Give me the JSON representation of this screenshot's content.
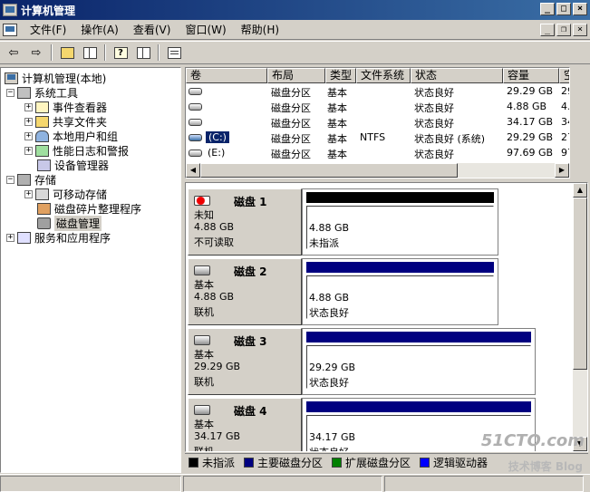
{
  "window": {
    "title": "计算机管理"
  },
  "menu": {
    "items": [
      "文件(F)",
      "操作(A)",
      "查看(V)",
      "窗口(W)",
      "帮助(H)"
    ]
  },
  "tree": {
    "root": "计算机管理(本地)",
    "system_tools": "系统工具",
    "event_viewer": "事件查看器",
    "shared_folders": "共享文件夹",
    "local_users": "本地用户和组",
    "perf_logs": "性能日志和警报",
    "device_manager": "设备管理器",
    "storage": "存储",
    "removable": "可移动存储",
    "defrag": "磁盘碎片整理程序",
    "disk_mgmt": "磁盘管理",
    "services": "服务和应用程序"
  },
  "volume_list": {
    "columns": [
      "卷",
      "布局",
      "类型",
      "文件系统",
      "状态",
      "容量",
      "空"
    ],
    "rows": [
      {
        "volume": "",
        "layout": "磁盘分区",
        "type": "基本",
        "fs": "",
        "status": "状态良好",
        "capacity": "29.29 GB",
        "free": "29"
      },
      {
        "volume": "",
        "layout": "磁盘分区",
        "type": "基本",
        "fs": "",
        "status": "状态良好",
        "capacity": "4.88 GB",
        "free": "4."
      },
      {
        "volume": "",
        "layout": "磁盘分区",
        "type": "基本",
        "fs": "",
        "status": "状态良好",
        "capacity": "34.17 GB",
        "free": "34"
      },
      {
        "volume": "(C:)",
        "layout": "磁盘分区",
        "type": "基本",
        "fs": "NTFS",
        "status": "状态良好 (系统)",
        "capacity": "29.29 GB",
        "free": "27"
      },
      {
        "volume": "(E:)",
        "layout": "磁盘分区",
        "type": "基本",
        "fs": "",
        "status": "状态良好",
        "capacity": "97.69 GB",
        "free": "97"
      }
    ]
  },
  "disks": [
    {
      "name": "磁盘 1",
      "type": "未知",
      "size": "4.88 GB",
      "state": "不可读取",
      "part_size": "4.88 GB",
      "part_status": "未指派",
      "bar_color": "#000000"
    },
    {
      "name": "磁盘 2",
      "type": "基本",
      "size": "4.88 GB",
      "state": "联机",
      "part_size": "4.88 GB",
      "part_status": "状态良好",
      "bar_color": "#000080"
    },
    {
      "name": "磁盘 3",
      "type": "基本",
      "size": "29.29 GB",
      "state": "联机",
      "part_size": "29.29 GB",
      "part_status": "状态良好",
      "bar_color": "#000080"
    },
    {
      "name": "磁盘 4",
      "type": "基本",
      "size": "34.17 GB",
      "state": "联机",
      "part_size": "34.17 GB",
      "part_status": "状态良好",
      "bar_color": "#000080"
    }
  ],
  "legend": [
    {
      "label": "未指派",
      "color": "#000000"
    },
    {
      "label": "主要磁盘分区",
      "color": "#000080"
    },
    {
      "label": "扩展磁盘分区",
      "color": "#008000"
    },
    {
      "label": "逻辑驱动器",
      "color": "#0000ff"
    }
  ],
  "watermark": {
    "main": "51CTO.com",
    "sub": "技术博客 Blog"
  }
}
